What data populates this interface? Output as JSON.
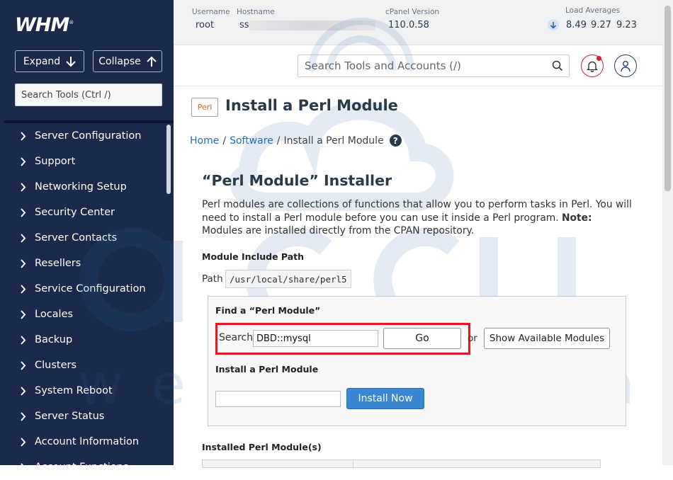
{
  "sidebar": {
    "logo": "WHM",
    "logo_mark": "®",
    "expand_label": "Expand",
    "collapse_label": "Collapse",
    "search_placeholder": "Search Tools (Ctrl /)",
    "items": [
      {
        "label": "Server Configuration"
      },
      {
        "label": "Support"
      },
      {
        "label": "Networking Setup"
      },
      {
        "label": "Security Center"
      },
      {
        "label": "Server Contacts"
      },
      {
        "label": "Resellers"
      },
      {
        "label": "Service Configuration"
      },
      {
        "label": "Locales"
      },
      {
        "label": "Backup"
      },
      {
        "label": "Clusters"
      },
      {
        "label": "System Reboot"
      },
      {
        "label": "Server Status"
      },
      {
        "label": "Account Information"
      },
      {
        "label": "Account Functions"
      }
    ]
  },
  "topbar": {
    "username_label": "Username",
    "username": "root",
    "hostname_label": "Hostname",
    "hostname": "ss",
    "cpanel_label": "cPanel Version",
    "cpanel_version": "110.0.58",
    "load_label": "Load Averages",
    "load_1": "8.49",
    "load_5": "9.27",
    "load_15": "9.23"
  },
  "header": {
    "search_placeholder": "Search Tools and Accounts (/)",
    "notification_color": "#d21f35"
  },
  "page": {
    "icon_text": "Perl",
    "title": "Install a Perl Module",
    "breadcrumb": [
      "Home",
      "Software",
      "Install a Perl Module"
    ],
    "section_title": "“Perl Module” Installer",
    "desc_main": "Perl modules are collections of functions that allow you to perform tasks in Perl. You will need to install a Perl module before you can use it inside a Perl program.",
    "desc_note_label": "Note:",
    "desc_note": "Modules are installed directly from the CPAN repository.",
    "include_path_heading": "Module Include Path",
    "path_label": "Path",
    "path_value": "/usr/local/share/perl5",
    "find_heading": "Find a “Perl Module”",
    "search_label": "Search",
    "search_value": "DBD::mysql",
    "go_label": "Go",
    "or_label": "or",
    "show_modules_label": "Show Available Modules",
    "install_heading": "Install a Perl Module",
    "install_label": "Install Now",
    "installed_heading": "Installed Perl Module(s)"
  },
  "watermark": {
    "brand": "accu",
    "tagline": "web hosting",
    "color": "#2f67b1"
  }
}
